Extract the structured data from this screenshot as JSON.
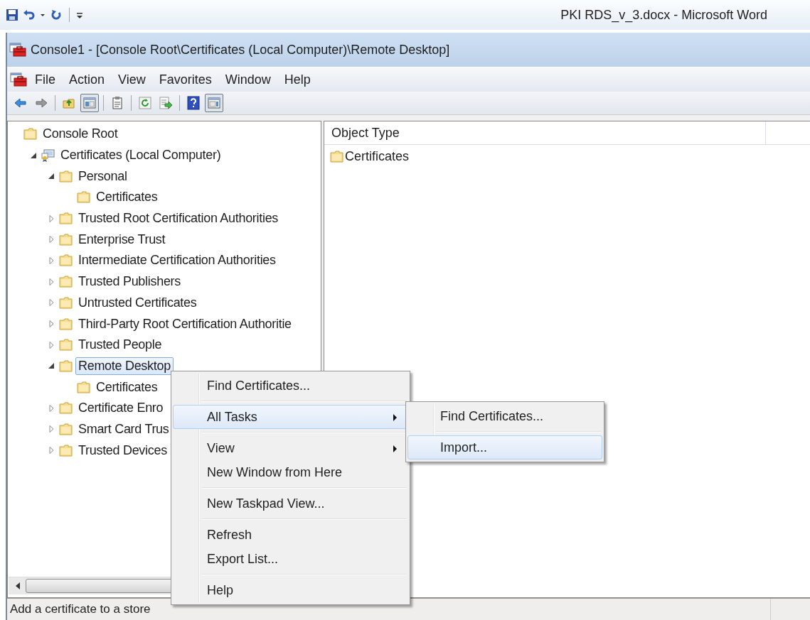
{
  "word_titlebar": {
    "quick_access": [
      {
        "kind": "save"
      },
      {
        "kind": "undo"
      },
      {
        "kind": "dropdown"
      },
      {
        "kind": "redo"
      },
      {
        "kind": "separator"
      },
      {
        "kind": "customize"
      }
    ],
    "title": "PKI RDS_v_3.docx - Microsoft Word"
  },
  "window": {
    "title": "Console1 - [Console Root\\Certificates (Local Computer)\\Remote Desktop]"
  },
  "menu_bar": [
    "File",
    "Action",
    "View",
    "Favorites",
    "Window",
    "Help"
  ],
  "toolbar": [
    {
      "kind": "back",
      "pressed": false
    },
    {
      "kind": "forward",
      "pressed": false
    },
    {
      "kind": "separator"
    },
    {
      "kind": "up",
      "pressed": false
    },
    {
      "kind": "tree-toggle",
      "pressed": true
    },
    {
      "kind": "separator"
    },
    {
      "kind": "properties",
      "pressed": false
    },
    {
      "kind": "separator"
    },
    {
      "kind": "refresh",
      "pressed": false
    },
    {
      "kind": "export",
      "pressed": false
    },
    {
      "kind": "separator"
    },
    {
      "kind": "help",
      "pressed": false
    },
    {
      "kind": "action-pane",
      "pressed": true
    }
  ],
  "tree": [
    {
      "label": "Console Root",
      "kind": "folder",
      "selected": false,
      "children": [
        {
          "label": "Certificates (Local Computer)",
          "kind": "store",
          "expanded": true,
          "selected": false,
          "children": [
            {
              "label": "Personal",
              "kind": "folder",
              "expanded": true,
              "selected": false,
              "children": [
                {
                  "label": "Certificates",
                  "kind": "folder",
                  "selected": false
                }
              ]
            },
            {
              "label": "Trusted Root Certification Authorities",
              "kind": "folder",
              "expanded": false,
              "selected": false
            },
            {
              "label": "Enterprise Trust",
              "kind": "folder",
              "expanded": false,
              "selected": false
            },
            {
              "label": "Intermediate Certification Authorities",
              "kind": "folder",
              "expanded": false,
              "selected": false
            },
            {
              "label": "Trusted Publishers",
              "kind": "folder",
              "expanded": false,
              "selected": false
            },
            {
              "label": "Untrusted Certificates",
              "kind": "folder",
              "expanded": false,
              "selected": false
            },
            {
              "label": "Third-Party Root Certification Authoritie",
              "kind": "folder",
              "expanded": false,
              "selected": false
            },
            {
              "label": "Trusted People",
              "kind": "folder",
              "expanded": false,
              "selected": false
            },
            {
              "label": "Remote Desktop",
              "kind": "folder",
              "expanded": true,
              "selected": true,
              "children": [
                {
                  "label": "Certificates",
                  "kind": "folder",
                  "selected": false
                }
              ]
            },
            {
              "label": "Certificate Enro",
              "kind": "folder",
              "expanded": false,
              "selected": false
            },
            {
              "label": "Smart Card Trus",
              "kind": "folder",
              "expanded": false,
              "selected": false
            },
            {
              "label": "Trusted Devices",
              "kind": "folder",
              "expanded": false,
              "selected": false
            }
          ]
        }
      ]
    }
  ],
  "list": {
    "columns": [
      "Object Type"
    ],
    "rows": [
      {
        "label": "Certificates",
        "kind": "folder"
      }
    ]
  },
  "context_menu": {
    "groups": [
      [
        {
          "label": "Find Certificates...",
          "submenu": false,
          "selected": false
        }
      ],
      [
        {
          "label": "All Tasks",
          "submenu": true,
          "selected": true
        }
      ],
      [
        {
          "label": "View",
          "submenu": true,
          "selected": false
        },
        {
          "label": "New Window from Here",
          "submenu": false,
          "selected": false
        }
      ],
      [
        {
          "label": "New Taskpad View...",
          "submenu": false,
          "selected": false
        }
      ],
      [
        {
          "label": "Refresh",
          "submenu": false,
          "selected": false
        },
        {
          "label": "Export List...",
          "submenu": false,
          "selected": false
        }
      ],
      [
        {
          "label": "Help",
          "submenu": false,
          "selected": false
        }
      ]
    ]
  },
  "submenu": {
    "groups": [
      [
        {
          "label": "Find Certificates...",
          "submenu": false,
          "selected": false
        }
      ],
      [
        {
          "label": "Import...",
          "submenu": false,
          "selected": true
        }
      ]
    ]
  },
  "status_bar": "Add a certificate to a store"
}
